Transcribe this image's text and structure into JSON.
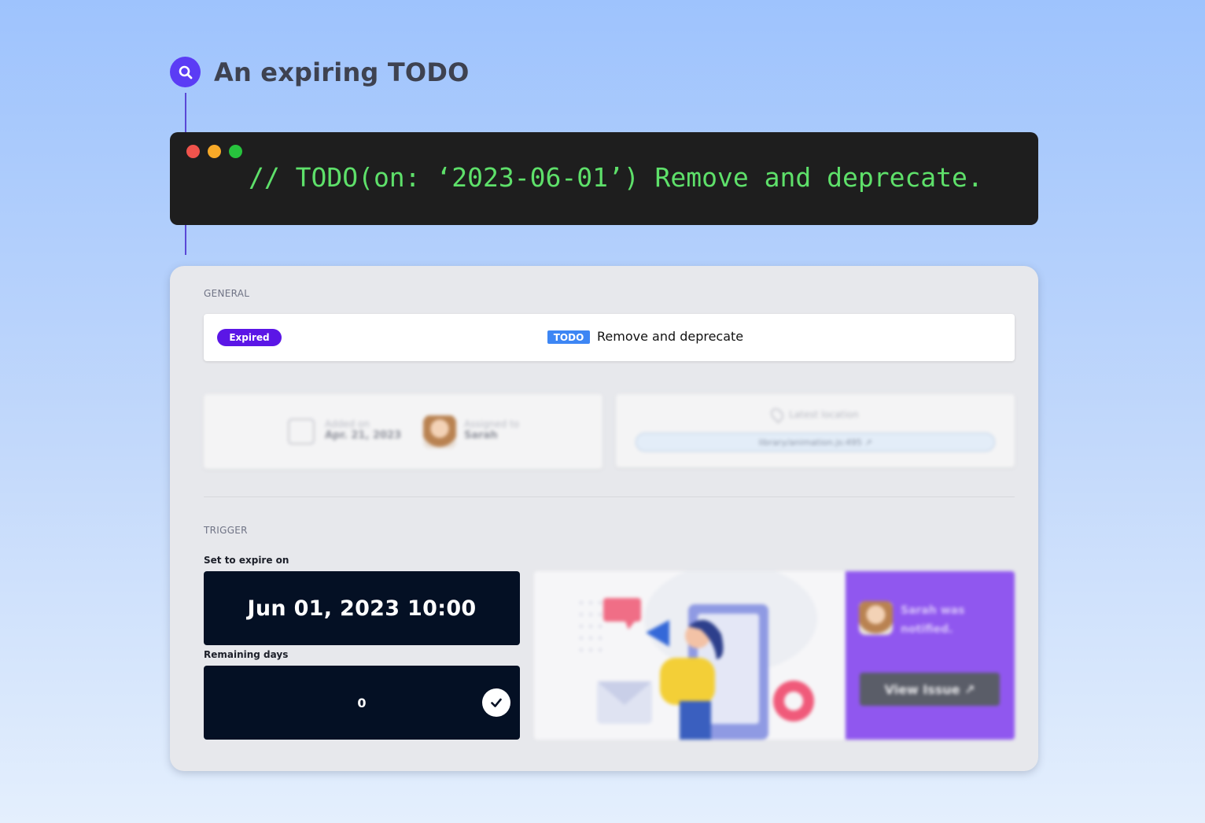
{
  "header": {
    "title": "An expiring TODO",
    "icon": "search-icon",
    "accent": "#5b3cf5"
  },
  "terminal": {
    "code": "// TODO(on: ‘2023-06-01’) Remove and deprecate.",
    "dots": [
      "#f0534c",
      "#f7a928",
      "#27c33d"
    ],
    "code_color": "#5ee06a"
  },
  "general": {
    "section_label": "GENERAL",
    "status_badge": "Expired",
    "todo_tag": "TODO",
    "todo_text": "Remove and deprecate"
  },
  "meta": {
    "added_label": "Added on",
    "added_value": "Apr. 21, 2023",
    "assigned_label": "Assigned to",
    "assigned_value": "Sarah",
    "location_label": "Latest location",
    "location_value": "library/animation.js:495 ↗"
  },
  "trigger": {
    "section_label": "TRIGGER",
    "expire_label": "Set to expire on",
    "expire_value": "Jun 01, 2023 10:00",
    "remaining_label": "Remaining days",
    "remaining_value": "0"
  },
  "notification": {
    "text": "Sarah was notified.",
    "button_label": "View Issue ↗"
  }
}
